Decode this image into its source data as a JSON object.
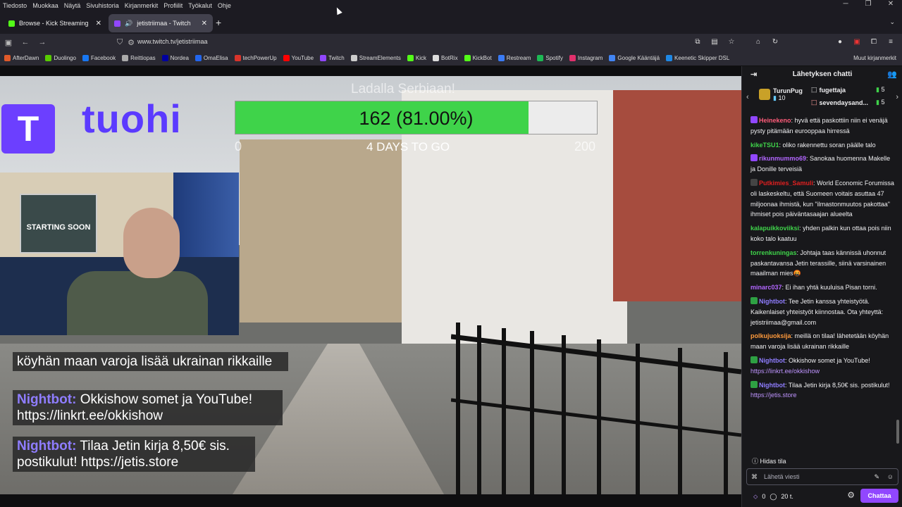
{
  "menubar": {
    "items": [
      "Tiedosto",
      "Muokkaa",
      "Näytä",
      "Sivuhistoria",
      "Kirjanmerkit",
      "Profiilit",
      "Työkalut",
      "Ohje"
    ]
  },
  "tabs": [
    {
      "title": "Browse - Kick Streaming",
      "icon_color": "#53fc18"
    },
    {
      "title": "jetistriimaa - Twitch",
      "icon_color": "#9147ff"
    }
  ],
  "navbar": {
    "url": "www.twitch.tv/jetistriimaa"
  },
  "bookmarks": [
    {
      "label": "AfterDawn",
      "color": "#e05a2a"
    },
    {
      "label": "Duolingo",
      "color": "#58cc02"
    },
    {
      "label": "Facebook",
      "color": "#1877f2"
    },
    {
      "label": "Reittiopas",
      "color": "#aaaaaa"
    },
    {
      "label": "Nordea",
      "color": "#0000a0"
    },
    {
      "label": "OmaElisa",
      "color": "#2266ee"
    },
    {
      "label": "techPowerUp",
      "color": "#d9342b"
    },
    {
      "label": "YouTube",
      "color": "#ff0000"
    },
    {
      "label": "Twitch",
      "color": "#9147ff"
    },
    {
      "label": "StreamElements",
      "color": "#cccccc"
    },
    {
      "label": "Kick",
      "color": "#53fc18"
    },
    {
      "label": "BotRix",
      "color": "#dddddd"
    },
    {
      "label": "KickBot",
      "color": "#53fc18"
    },
    {
      "label": "Restream",
      "color": "#3a7bf5"
    },
    {
      "label": "Spotify",
      "color": "#1db954"
    },
    {
      "label": "Instagram",
      "color": "#e1306c"
    },
    {
      "label": "Google Kääntäjä",
      "color": "#4285f4"
    },
    {
      "label": "Keenetic Skipper DSL",
      "color": "#1e88e5"
    }
  ],
  "bookmarks_other": "Muut kirjanmerkit",
  "stream": {
    "logo_letter": "T",
    "logo_text": "tuohi",
    "goal_title": "Ladalla Serbiaan!",
    "goal_value": "162 (81.00%)",
    "goal_progress": 0.81,
    "goal_min": "0",
    "goal_max": "200",
    "goal_days": "4 DAYS TO GO",
    "poster_text": "STARTING SOON",
    "overlay_messages": [
      {
        "user": "",
        "text": "köyhän maan varoja lisää ukrainan rikkaille"
      },
      {
        "user": "Nightbot:",
        "text": "Okkishow somet ja YouTube! https://linkrt.ee/okkishow"
      },
      {
        "user": "Nightbot:",
        "text": "Tilaa Jetin kirja 8,50€ sis. postikulut! https://jetis.store"
      }
    ]
  },
  "chat": {
    "title": "Lähetyksen chatti",
    "gifters": {
      "top_name": "TurunPug",
      "top_count": "10",
      "rows": [
        {
          "name": "fugettaja",
          "count": "5"
        },
        {
          "name": "sevendaysand...",
          "count": "5"
        }
      ]
    },
    "messages": [
      {
        "user": "Heinekeno",
        "color": "#ff5c7a",
        "badge": "#9147ff",
        "text": "hyvä että paskottiin niin ei venäjä pysty pitämään eurooppaa hirressä"
      },
      {
        "user": "kikeTSU1",
        "color": "#3fd34a",
        "badge": "",
        "text": "oliko rakennettu soran päälle talo"
      },
      {
        "user": "rikunmummo69",
        "color": "#b266ff",
        "badge": "#9147ff",
        "text": "Sanokaa huomenna Makelle ja Donille terveisiä"
      },
      {
        "user": "Putkimies_Samuli",
        "color": "#e02020",
        "badge": "#444444",
        "text": "World Economic Forumissa oli laskeskeltu, että Suomeen voitais asuttaa 47 miljoonaa ihmistä, kun \"ilmastonmuutos pakottaa\" ihmiset pois päiväntasaajan alueelta"
      },
      {
        "user": "kalapuikkoviiksi",
        "color": "#3fd34a",
        "badge": "",
        "text": "yhden palkin kun ottaa pois niin koko talo kaatuu"
      },
      {
        "user": "torrenkuningas",
        "color": "#3fd34a",
        "badge": "",
        "text": "Johtaja taas kännissä uhonnut paskantavansa Jetin terassille, siinä varsinainen maailman mies🤬"
      },
      {
        "user": "minarc037",
        "color": "#b266ff",
        "badge": "",
        "text": "Ei ihan yhtä kuuluisa Pisan torni."
      },
      {
        "user": "Nightbot",
        "color": "#8f7dff",
        "badge": "#2ea043",
        "text": "Tee Jetin kanssa yhteistyötä. Kaikenlaiset yhteistyöt kiinnostaa. Ota yhteyttä: jetistriimaa@gmail.com"
      },
      {
        "user": "polkujuoksija",
        "color": "#ff9a3c",
        "badge": "",
        "text": "meillä on tilaa! lähetetään köyhän maan varoja lisää ukrainan rikkaille"
      },
      {
        "user": "Nightbot",
        "color": "#8f7dff",
        "badge": "#2ea043",
        "text": "Okkishow somet ja YouTube!",
        "link": "https://linkrt.ee/okkishow"
      },
      {
        "user": "Nightbot",
        "color": "#8f7dff",
        "badge": "#2ea043",
        "text": "Tilaa Jetin kirja 8,50€ sis. postikulut!",
        "link": "https://jetis.store"
      }
    ],
    "slow_mode": "Hidas tila",
    "input_placeholder": "Lähetä viesti",
    "points": "0",
    "timer": "20 t.",
    "send_label": "Chattaa"
  }
}
